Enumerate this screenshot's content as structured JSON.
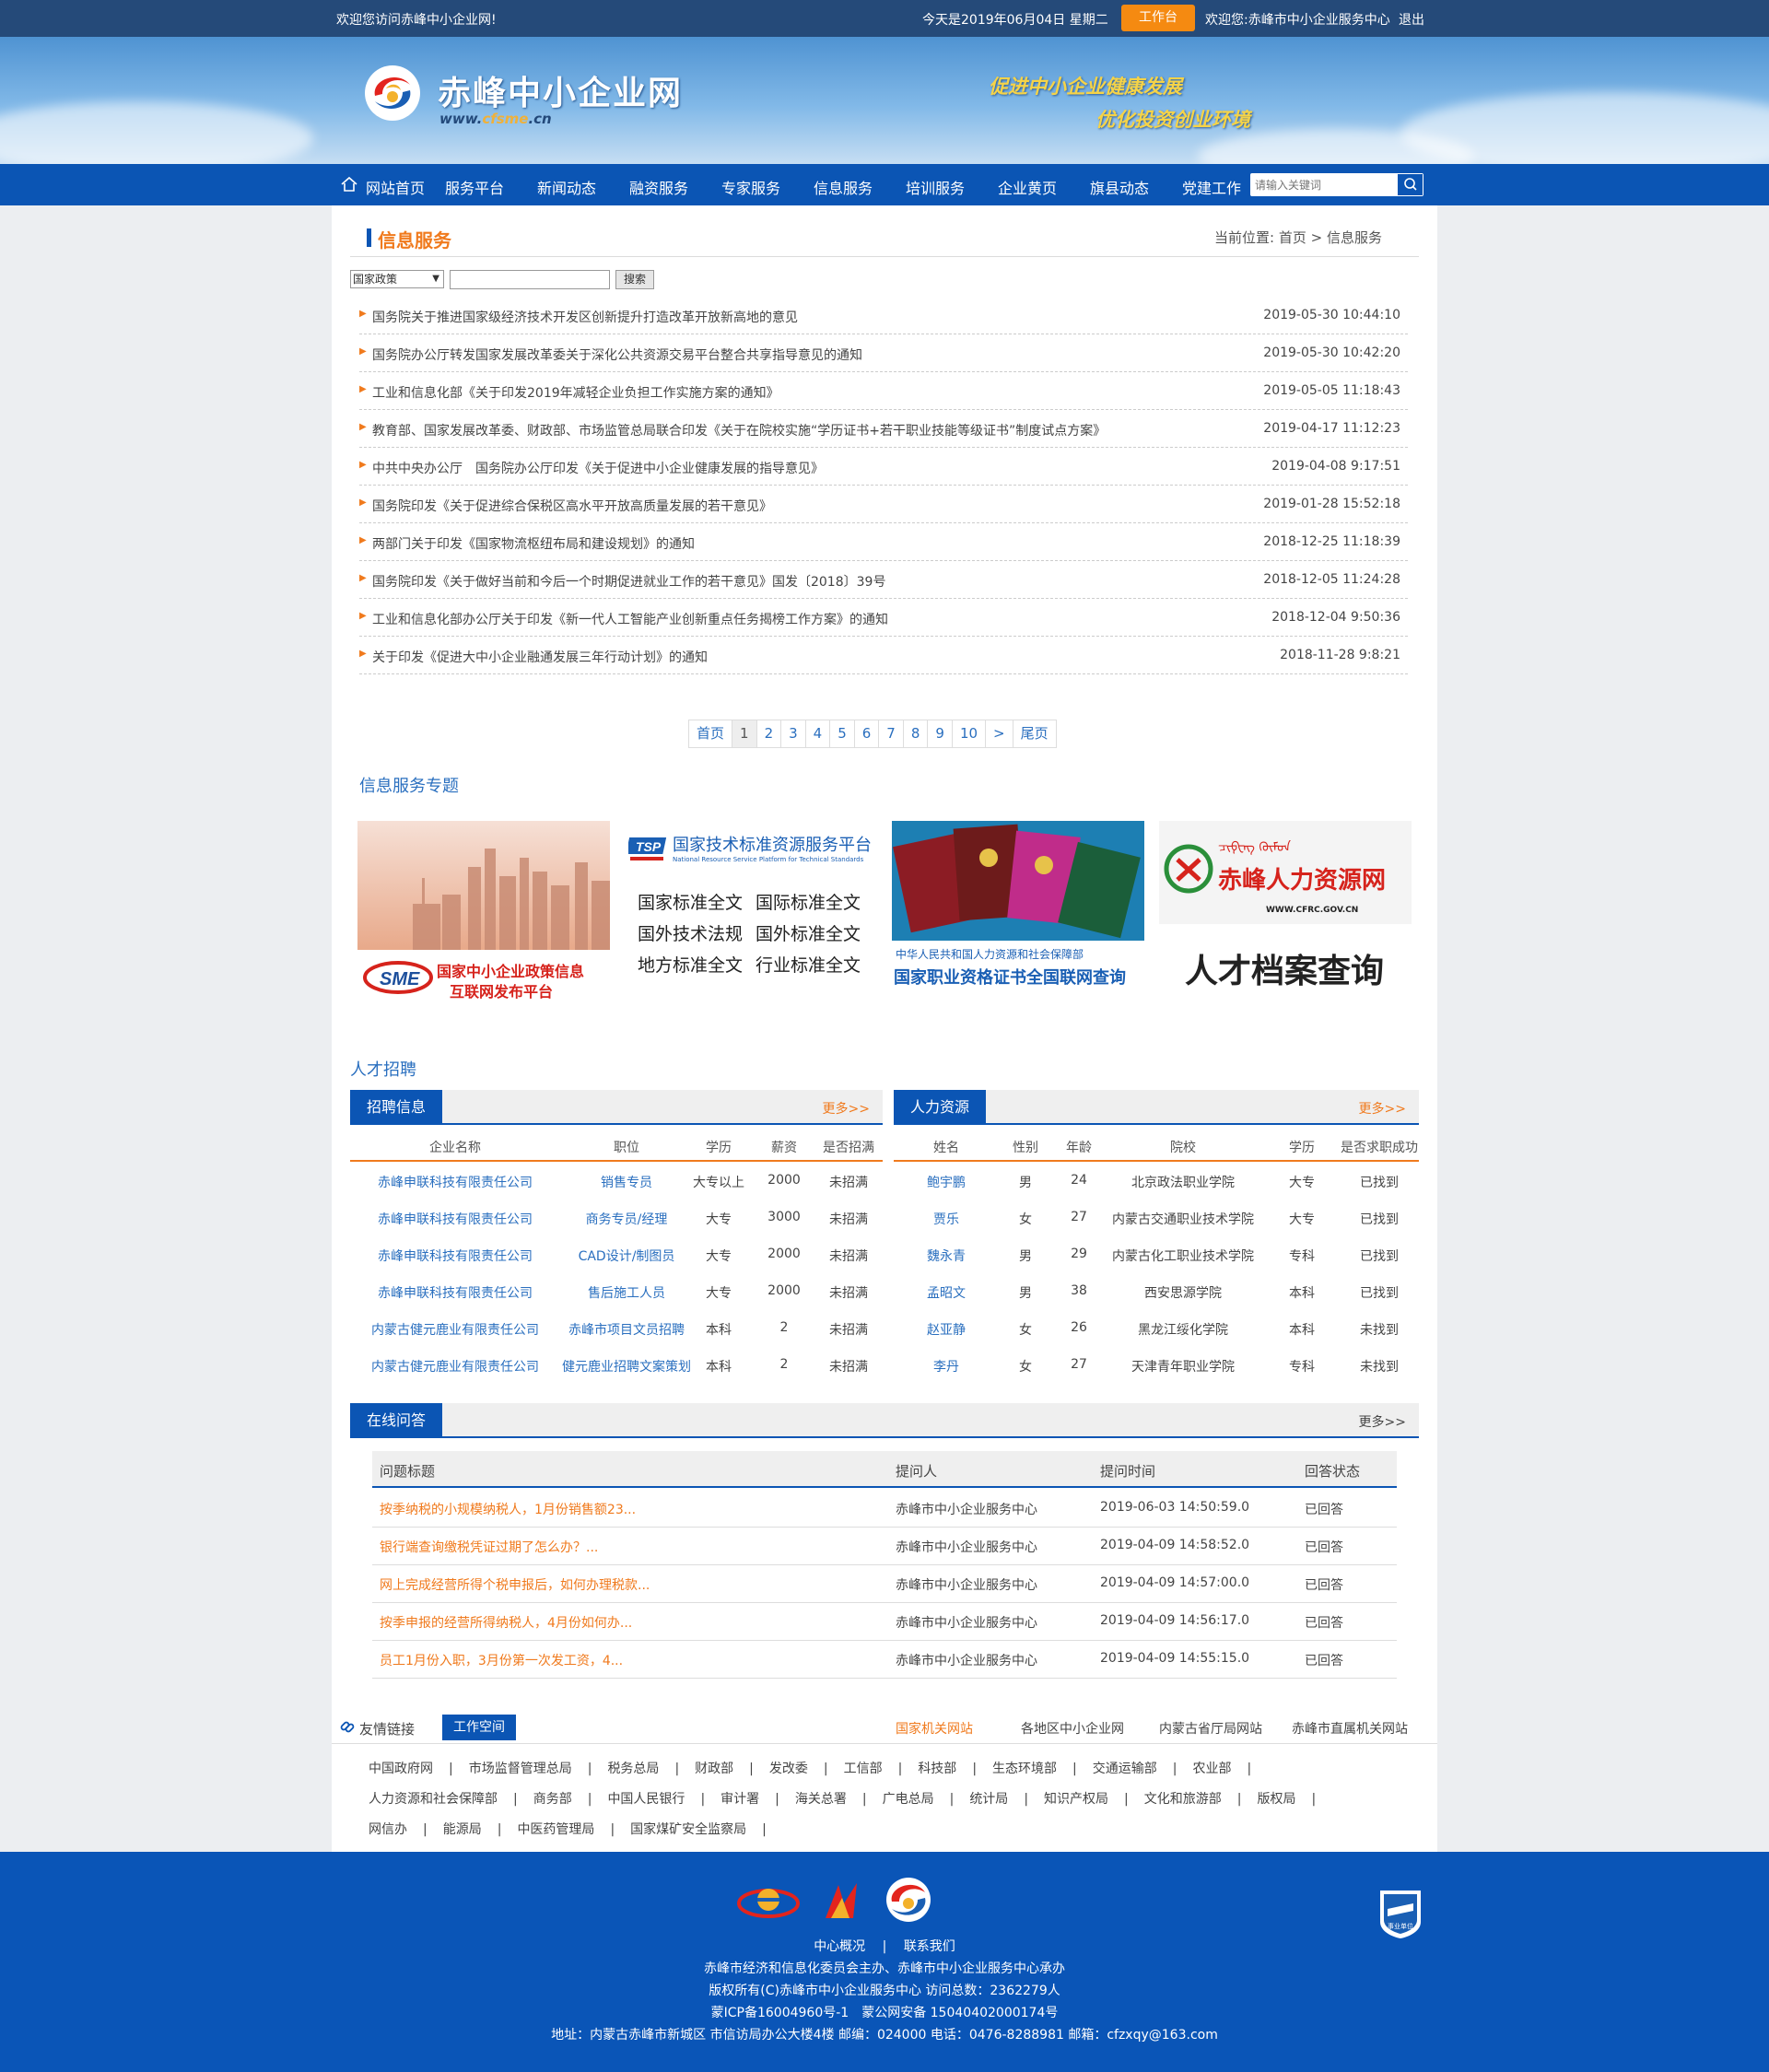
{
  "topbar": {
    "welcome": "欢迎您访问赤峰中小企业网!",
    "date": "今天是2019年06月04日 星期二",
    "workspace_btn": "工作台",
    "user": "欢迎您:赤峰市中小企业服务中心",
    "logout": "退出"
  },
  "header": {
    "site_name": "赤峰中小企业网",
    "domain_prefix": "www.",
    "domain_hl": "cfsme",
    "domain_suffix": ".cn",
    "slogan1": "促进中小企业健康发展",
    "slogan2": "优化投资创业环境"
  },
  "nav": {
    "items": [
      "网站首页",
      "服务平台",
      "新闻动态",
      "融资服务",
      "专家服务",
      "信息服务",
      "培训服务",
      "企业黄页",
      "旗县动态",
      "党建工作"
    ],
    "search_placeholder": "请输入关键词"
  },
  "page": {
    "section_title": "信息服务",
    "crumb_label": "当前位置:",
    "crumb_home": "首页",
    "crumb_sep": ">",
    "crumb_current": "信息服务",
    "filter_option": "国家政策",
    "search_btn": "搜索"
  },
  "news": [
    {
      "title": "国务院关于推进国家级经济技术开发区创新提升打造改革开放新高地的意见",
      "time": "2019-05-30 10:44:10"
    },
    {
      "title": "国务院办公厅转发国家发展改革委关于深化公共资源交易平台整合共享指导意见的通知",
      "time": "2019-05-30 10:42:20"
    },
    {
      "title": "工业和信息化部《关于印发2019年减轻企业负担工作实施方案的通知》",
      "time": "2019-05-05 11:18:43"
    },
    {
      "title": "教育部、国家发展改革委、财政部、市场监管总局联合印发《关于在院校实施“学历证书+若干职业技能等级证书”制度试点方案》",
      "time": "2019-04-17 11:12:23"
    },
    {
      "title": "中共中央办公厅　国务院办公厅印发《关于促进中小企业健康发展的指导意见》",
      "time": "2019-04-08 9:17:51"
    },
    {
      "title": "国务院印发《关于促进综合保税区高水平开放高质量发展的若干意见》",
      "time": "2019-01-28 15:52:18"
    },
    {
      "title": "两部门关于印发《国家物流枢纽布局和建设规划》的通知",
      "time": "2018-12-25 11:18:39"
    },
    {
      "title": "国务院印发《关于做好当前和今后一个时期促进就业工作的若干意见》国发〔2018〕39号",
      "time": "2018-12-05 11:24:28"
    },
    {
      "title": "工业和信息化部办公厅关于印发《新一代人工智能产业创新重点任务揭榜工作方案》的通知",
      "time": "2018-12-04 9:50:36"
    },
    {
      "title": "关于印发《促进大中小企业融通发展三年行动计划》的通知",
      "time": "2018-11-28 9:8:21"
    }
  ],
  "pager": [
    "首页",
    "1",
    "2",
    "3",
    "4",
    "5",
    "6",
    "7",
    "8",
    "9",
    "10",
    ">",
    "尾页"
  ],
  "topics": {
    "title": "信息服务专题",
    "banner1": {
      "logo": "SME",
      "line1": "国家中小企业政策信息",
      "line2": "互联网发布平台"
    },
    "banner2": {
      "logo": "TSP",
      "title": "国家技术标准资源服务平台",
      "subtitle": "National Resource Service Platform for Technical Standards",
      "items": [
        "国家标准全文",
        "国际标准全文",
        "国外技术法规",
        "国外标准全文",
        "地方标准全文",
        "行业标准全文"
      ]
    },
    "banner3": {
      "line1": "中华人民共和国人力资源和社会保障部",
      "line2": "国家职业资格证书全国联网查询"
    },
    "banner4": {
      "name": "赤峰人力资源网",
      "url": "WWW.CFRC.GOV.CN",
      "caption": "人才档案查询"
    }
  },
  "talent": {
    "title": "人才招聘",
    "recruit": {
      "tab": "招聘信息",
      "more": "更多>>",
      "headers": [
        "企业名称",
        "职位",
        "学历",
        "薪资",
        "是否招满"
      ],
      "rows": [
        [
          "赤峰申联科技有限责任公司",
          "销售专员",
          "大专以上",
          "2000",
          "未招满"
        ],
        [
          "赤峰申联科技有限责任公司",
          "商务专员/经理",
          "大专",
          "3000",
          "未招满"
        ],
        [
          "赤峰申联科技有限责任公司",
          "CAD设计/制图员",
          "大专",
          "2000",
          "未招满"
        ],
        [
          "赤峰申联科技有限责任公司",
          "售后施工人员",
          "大专",
          "2000",
          "未招满"
        ],
        [
          "内蒙古健元鹿业有限责任公司",
          "赤峰市项目文员招聘",
          "本科",
          "2",
          "未招满"
        ],
        [
          "内蒙古健元鹿业有限责任公司",
          "健元鹿业招聘文案策划",
          "本科",
          "2",
          "未招满"
        ]
      ]
    },
    "hr": {
      "tab": "人力资源",
      "more": "更多>>",
      "headers": [
        "姓名",
        "性别",
        "年龄",
        "院校",
        "学历",
        "是否求职成功"
      ],
      "rows": [
        [
          "鲍宇鹏",
          "男",
          "24",
          "北京政法职业学院",
          "大专",
          "已找到"
        ],
        [
          "贾乐",
          "女",
          "27",
          "内蒙古交通职业技术学院",
          "大专",
          "已找到"
        ],
        [
          "魏永青",
          "男",
          "29",
          "内蒙古化工职业技术学院",
          "专科",
          "已找到"
        ],
        [
          "孟昭文",
          "男",
          "38",
          "西安思源学院",
          "本科",
          "已找到"
        ],
        [
          "赵亚静",
          "女",
          "26",
          "黑龙江绥化学院",
          "本科",
          "未找到"
        ],
        [
          "李丹",
          "女",
          "27",
          "天津青年职业学院",
          "专科",
          "未找到"
        ]
      ]
    }
  },
  "qa": {
    "tab": "在线问答",
    "more": "更多>>",
    "headers": [
      "问题标题",
      "提问人",
      "提问时间",
      "回答状态"
    ],
    "rows": [
      [
        "按季纳税的小规模纳税人，1月份销售额23...",
        "赤峰市中小企业服务中心",
        "2019-06-03 14:50:59.0",
        "已回答"
      ],
      [
        "银行端查询缴税凭证过期了怎么办？...",
        "赤峰市中小企业服务中心",
        "2019-04-09 14:58:52.0",
        "已回答"
      ],
      [
        "网上完成经营所得个税申报后，如何办理税款...",
        "赤峰市中小企业服务中心",
        "2019-04-09 14:57:00.0",
        "已回答"
      ],
      [
        "按季申报的经营所得纳税人，4月份如何办...",
        "赤峰市中小企业服务中心",
        "2019-04-09 14:56:17.0",
        "已回答"
      ],
      [
        "员工1月份入职，3月份第一次发工资，4...",
        "赤峰市中小企业服务中心",
        "2019-04-09 14:55:15.0",
        "已回答"
      ]
    ]
  },
  "links": {
    "label": "友情链接",
    "active_tab": "工作空间",
    "tabs": [
      "国家机关网站",
      "各地区中小企业网",
      "内蒙古省厅局网站",
      "赤峰市直属机关网站"
    ],
    "row1": [
      "中国政府网",
      "市场监督管理总局",
      "税务总局",
      "财政部",
      "发改委",
      "工信部",
      "科技部",
      "生态环境部",
      "交通运输部",
      "农业部"
    ],
    "row2": [
      "人力资源和社会保障部",
      "商务部",
      "中国人民银行",
      "审计署",
      "海关总署",
      "广电总局",
      "统计局",
      "知识产权局",
      "文化和旅游部",
      "版权局"
    ],
    "row3": [
      "网信办",
      "能源局",
      "中医药管理局",
      "国家煤矿安全监察局"
    ]
  },
  "footer": {
    "nav1": "中心概况",
    "nav_sep": "|",
    "nav2": "联系我们",
    "line1": "赤峰市经济和信息化委员会主办、赤峰市中小企业服务中心承办",
    "line2": "版权所有(C)赤峰市中小企业服务中心 访问总数：2362279人",
    "line3": "蒙ICP备16004960号-1　蒙公网安备 15040402000174号",
    "line4": "地址：内蒙古赤峰市新城区 市信访局办公大楼4楼 邮编：024000 电话：0476-8288981 邮箱：cfzxqy@163.com",
    "badge": "事业单位"
  },
  "colors": {
    "nav_blue": "#0b55b4",
    "accent_orange": "#f07a1d",
    "link_blue": "#2a6fbf",
    "topbar": "#254a79"
  }
}
